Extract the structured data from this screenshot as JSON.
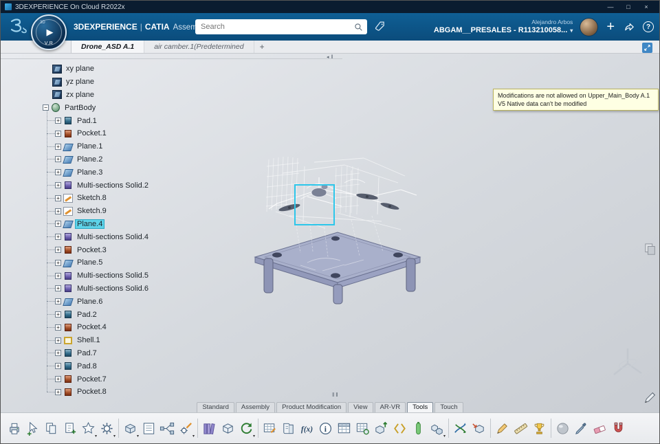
{
  "window": {
    "title": "3DEXPERIENCE On Cloud R2022x",
    "controls": [
      {
        "name": "minimize-icon",
        "glyph": "—"
      },
      {
        "name": "maximize-icon",
        "glyph": "□"
      },
      {
        "name": "close-icon",
        "glyph": "×"
      }
    ]
  },
  "header": {
    "brand": "3DEXPERIENCE",
    "separator": "|",
    "app": "CATIA",
    "app_context": "Assembly ...",
    "search": {
      "placeholder": "Search"
    },
    "compass": {
      "top": "3D",
      "bottom": "V.R"
    },
    "account": {
      "user": "Alejandro Arbos",
      "tenant": "ABGAM__PRESALES - R113210058..."
    }
  },
  "doc_tabs": {
    "tabs": [
      {
        "label": "Drone_ASD A.1",
        "active": true
      },
      {
        "label": "air camber.1(Predetermined",
        "active": false
      }
    ],
    "add_label": "+"
  },
  "notification": {
    "line1": "Modifications are not allowed on Upper_Main_Body A.1",
    "line2": "V5 Native data can't be modified"
  },
  "tree": {
    "items": [
      {
        "label": "xy plane",
        "icon": "axis-plane",
        "level": 1
      },
      {
        "label": "yz plane",
        "icon": "axis-plane",
        "level": 1
      },
      {
        "label": "zx plane",
        "icon": "axis-plane",
        "level": 1
      },
      {
        "label": "PartBody",
        "icon": "body",
        "level": 1,
        "expander": "minus"
      },
      {
        "label": "Pad.1",
        "icon": "pad",
        "level": 2,
        "expander": "plus"
      },
      {
        "label": "Pocket.1",
        "icon": "pocket",
        "level": 2,
        "expander": "plus"
      },
      {
        "label": "Plane.1",
        "icon": "plane",
        "level": 2,
        "expander": "plus"
      },
      {
        "label": "Plane.2",
        "icon": "plane",
        "level": 2,
        "expander": "plus"
      },
      {
        "label": "Plane.3",
        "icon": "plane",
        "level": 2,
        "expander": "plus"
      },
      {
        "label": "Multi-sections Solid.2",
        "icon": "solid",
        "level": 2,
        "expander": "plus"
      },
      {
        "label": "Sketch.8",
        "icon": "sketch",
        "level": 2,
        "expander": "plus"
      },
      {
        "label": "Sketch.9",
        "icon": "sketch",
        "level": 2,
        "expander": "plus"
      },
      {
        "label": "Plane.4",
        "icon": "plane",
        "level": 2,
        "expander": "plus",
        "selected": true
      },
      {
        "label": "Multi-sections Solid.4",
        "icon": "solid",
        "level": 2,
        "expander": "plus"
      },
      {
        "label": "Pocket.3",
        "icon": "pocket",
        "level": 2,
        "expander": "plus"
      },
      {
        "label": "Plane.5",
        "icon": "plane",
        "level": 2,
        "expander": "plus"
      },
      {
        "label": "Multi-sections Solid.5",
        "icon": "solid",
        "level": 2,
        "expander": "plus"
      },
      {
        "label": "Multi-sections Solid.6",
        "icon": "solid",
        "level": 2,
        "expander": "plus"
      },
      {
        "label": "Plane.6",
        "icon": "plane",
        "level": 2,
        "expander": "plus"
      },
      {
        "label": "Pad.2",
        "icon": "pad",
        "level": 2,
        "expander": "plus"
      },
      {
        "label": "Pocket.4",
        "icon": "pocket",
        "level": 2,
        "expander": "plus"
      },
      {
        "label": "Shell.1",
        "icon": "shell",
        "level": 2,
        "expander": "plus"
      },
      {
        "label": "Pad.7",
        "icon": "pad",
        "level": 2,
        "expander": "plus"
      },
      {
        "label": "Pad.8",
        "icon": "pad",
        "level": 2,
        "expander": "plus"
      },
      {
        "label": "Pocket.7",
        "icon": "pocket",
        "level": 2,
        "expander": "plus"
      },
      {
        "label": "Pocket.8",
        "icon": "pocket",
        "level": 2,
        "expander": "plus"
      }
    ]
  },
  "ribbon": {
    "tabs": [
      {
        "label": "Standard"
      },
      {
        "label": "Assembly"
      },
      {
        "label": "Product Modification"
      },
      {
        "label": "View"
      },
      {
        "label": "AR-VR"
      },
      {
        "label": "Tools",
        "active": true
      },
      {
        "label": "Touch"
      }
    ]
  },
  "toolbar": {
    "groups": [
      {
        "icons": [
          {
            "name": "print-icon",
            "kind": "printer"
          },
          {
            "name": "selection-sets-icon",
            "kind": "cursor"
          },
          {
            "name": "paste-format-icon",
            "kind": "docs"
          },
          {
            "name": "new-content-icon",
            "kind": "doc-plus"
          },
          {
            "name": "favorites-icon",
            "kind": "star",
            "dd": true
          },
          {
            "name": "options-gear-icon",
            "kind": "gear",
            "dd": true
          }
        ]
      },
      {
        "icons": [
          {
            "name": "insert-existing-icon",
            "kind": "box-arrow",
            "dd": true
          },
          {
            "name": "specification-list-icon",
            "kind": "list"
          },
          {
            "name": "structure-links-icon",
            "kind": "branch"
          },
          {
            "name": "edit-parameters-icon",
            "kind": "gear-pencil",
            "dd": true
          }
        ]
      },
      {
        "icons": [
          {
            "name": "catalog-binder-icon",
            "kind": "binder"
          },
          {
            "name": "bounding-box-icon",
            "kind": "cube"
          },
          {
            "name": "update-refresh-icon",
            "kind": "refresh",
            "dd": true
          }
        ]
      },
      {
        "icons": [
          {
            "name": "design-table-icon",
            "kind": "grid-pencil"
          },
          {
            "name": "knowledge-book-icon",
            "kind": "book-arrow"
          },
          {
            "name": "formula-fx-icon",
            "kind": "fx"
          },
          {
            "name": "information-icon",
            "kind": "info-i"
          },
          {
            "name": "table-icon",
            "kind": "table"
          },
          {
            "name": "parameter-table-icon",
            "kind": "table-gear"
          },
          {
            "name": "export-box-icon",
            "kind": "box-up"
          },
          {
            "name": "expression-brackets-icon",
            "kind": "angles"
          },
          {
            "name": "battery-level-icon",
            "kind": "capsule"
          },
          {
            "name": "component-boxes-icon",
            "kind": "boxes",
            "dd": true
          }
        ]
      },
      {
        "icons": [
          {
            "name": "exchange-arrows-icon",
            "kind": "arrows-cross"
          },
          {
            "name": "import-box-icon",
            "kind": "box-in"
          }
        ]
      },
      {
        "icons": [
          {
            "name": "annotation-pencil-icon",
            "kind": "pencil"
          },
          {
            "name": "measure-ruler-icon",
            "kind": "ruler"
          },
          {
            "name": "award-trophy-icon",
            "kind": "trophy"
          }
        ]
      },
      {
        "icons": [
          {
            "name": "material-sphere-icon",
            "kind": "sphere"
          },
          {
            "name": "color-picker-icon",
            "kind": "dropper"
          },
          {
            "name": "eraser-icon",
            "kind": "eraser"
          },
          {
            "name": "magnet-snap-icon",
            "kind": "magnet"
          }
        ]
      }
    ]
  },
  "colors": {
    "header_blue": "#0d5586",
    "selection_cyan": "#5ed2e8",
    "tooltip_yellow": "#feffe3",
    "table_lavender": "#a9b0cb",
    "accent_blue": "#3f87c5"
  }
}
